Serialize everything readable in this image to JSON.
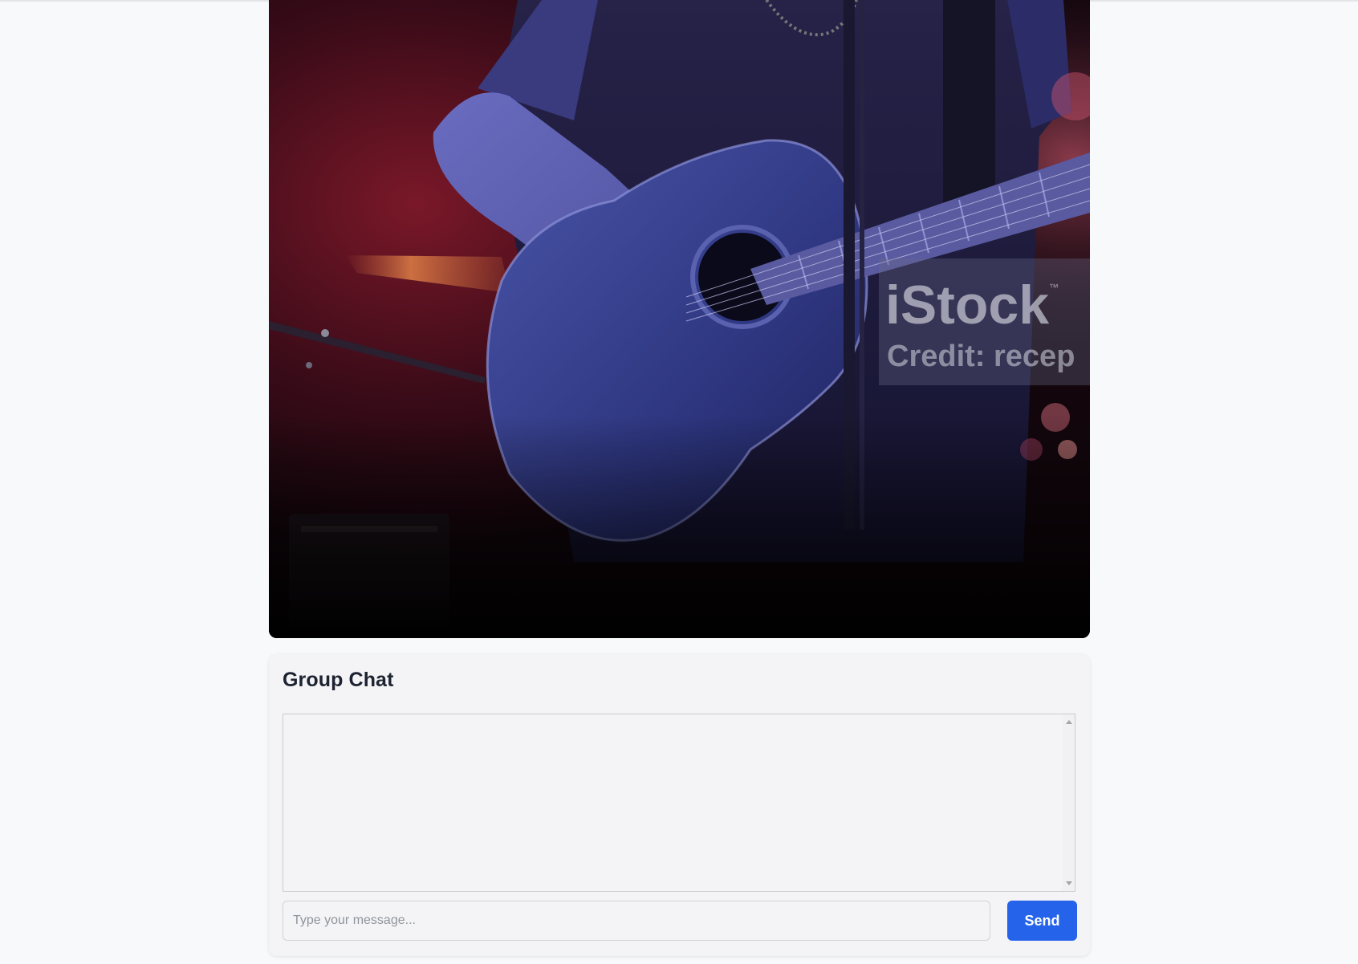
{
  "stream": {
    "image_alt": "Musician playing acoustic guitar on stage",
    "watermark": {
      "brand": "iStock",
      "trademark": "™",
      "credit": "Credit: recep"
    }
  },
  "chat": {
    "title": "Group Chat",
    "messages": [],
    "input_placeholder": "Type your message...",
    "input_value": "",
    "send_label": "Send"
  },
  "colors": {
    "page_background": "#f8f9fb",
    "panel_background": "#f4f4f6",
    "send_button": "#2563eb",
    "title_text": "#1c2230"
  }
}
